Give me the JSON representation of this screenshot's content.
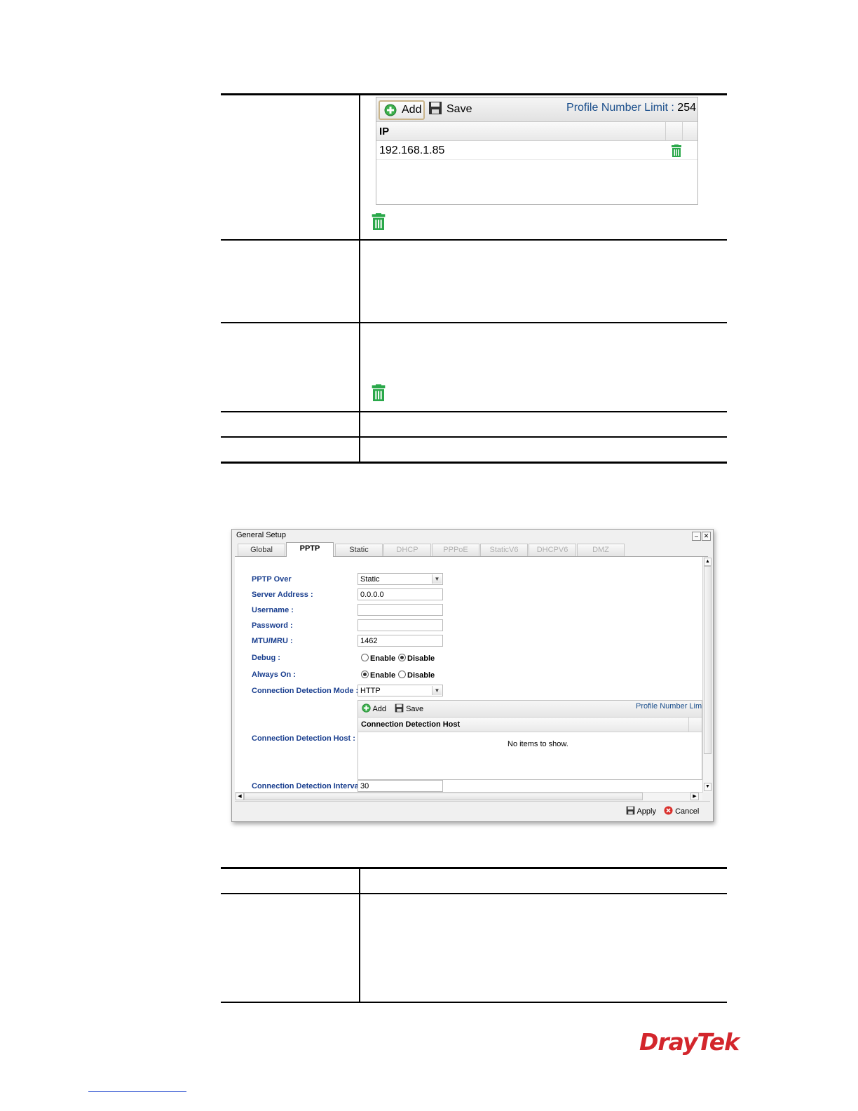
{
  "top_table": {
    "ip_list": {
      "add_label": "Add",
      "save_label": "Save",
      "limit_label": "Profile Number Limit :",
      "limit_value": "254",
      "column_ip": "IP",
      "rows": [
        {
          "ip": "192.168.1.85"
        }
      ]
    },
    "trash_icon": "trash-icon"
  },
  "dialog": {
    "title": "General Setup",
    "tabs": [
      {
        "label": "Global",
        "state": "normal"
      },
      {
        "label": "PPTP",
        "state": "active"
      },
      {
        "label": "Static",
        "state": "normal"
      },
      {
        "label": "DHCP",
        "state": "disabled"
      },
      {
        "label": "PPPoE",
        "state": "disabled"
      },
      {
        "label": "StaticV6",
        "state": "disabled"
      },
      {
        "label": "DHCPV6",
        "state": "disabled"
      },
      {
        "label": "DMZ",
        "state": "disabled"
      }
    ],
    "fields": {
      "pptp_over": {
        "label": "PPTP Over",
        "value": "Static"
      },
      "server_address": {
        "label": "Server Address :",
        "value": "0.0.0.0"
      },
      "username": {
        "label": "Username :",
        "value": ""
      },
      "password": {
        "label": "Password :",
        "value": ""
      },
      "mtu_mru": {
        "label": "MTU/MRU :",
        "value": "1462"
      },
      "debug": {
        "label": "Debug :",
        "enable": "Enable",
        "disable": "Disable",
        "selected": "Disable"
      },
      "always_on": {
        "label": "Always On :",
        "enable": "Enable",
        "disable": "Disable",
        "selected": "Enable"
      },
      "detection_mode": {
        "label": "Connection Detection Mode :",
        "value": "HTTP"
      },
      "detection_host": {
        "label": "Connection Detection Host :",
        "add_label": "Add",
        "save_label": "Save",
        "limit_label": "Profile Number Limi",
        "column": "Connection Detection Host",
        "empty_text": "No items to show."
      },
      "detection_interval": {
        "label": "Connection Detection Interval :",
        "value": "30"
      }
    },
    "apply_label": "Apply",
    "cancel_label": "Cancel"
  },
  "logo": {
    "text": "DrayTek",
    "color": "#d3262c"
  },
  "colors": {
    "label_blue": "#1a3f8f",
    "limit_blue": "#1b4f8c",
    "trash_green": "#2aa84a"
  }
}
